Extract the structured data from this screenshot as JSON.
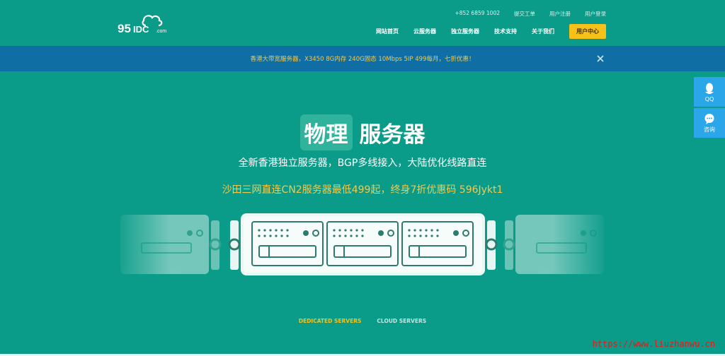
{
  "header": {
    "logo_text": "95IDC.com",
    "top_links": [
      "+852 6859 1002",
      "提交工单",
      "用户注册",
      "用户登录"
    ],
    "nav": [
      "网站首页",
      "云服务器",
      "独立服务器",
      "技术支持",
      "关于我们"
    ],
    "user_center": "用户中心"
  },
  "banner": {
    "text": "香港大带宽服务器，X3450 8G内存 240G固态 10Mbps 5IP 499每月，七折优惠！"
  },
  "side": {
    "qq": "QQ",
    "consult": "咨询"
  },
  "hero": {
    "title_highlight": "物理",
    "title_rest": "服务器",
    "subtitle": "全新香港独立服务器，BGP多线接入，大陆优化线路直连",
    "promo": "沙田三网直连CN2服务器最低499起，终身7折优惠码 596Jykt1"
  },
  "tabs": [
    "DEDICATED SERVERS",
    "CLOUD SERVERS"
  ],
  "watermark": "https://www.liuzhanwu.cn",
  "colors": {
    "bg": "#0a9c88",
    "banner": "#0f6fa5",
    "accent": "#f6c21a",
    "side": "#2ba6e8"
  }
}
